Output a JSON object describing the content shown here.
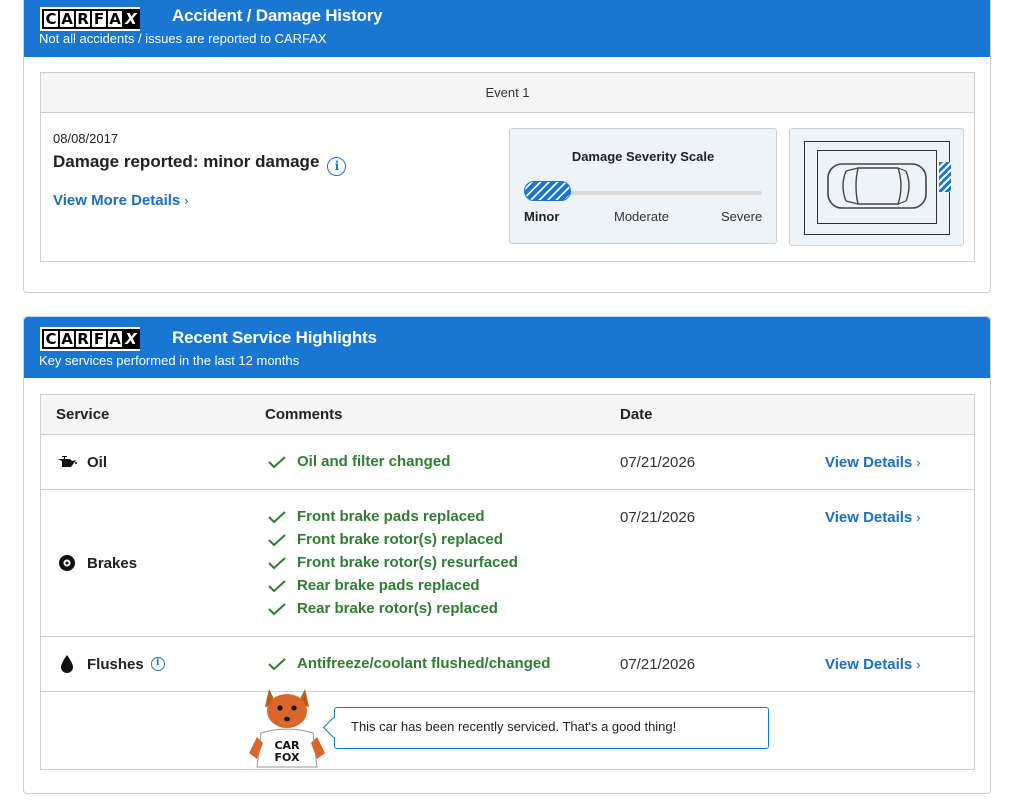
{
  "logo_letters": [
    "C",
    "A",
    "R",
    "F",
    "A",
    "X"
  ],
  "accident": {
    "title": "Accident / Damage History",
    "subtitle": "Not all accidents / issues are reported to CARFAX",
    "event_label": "Event 1",
    "date": "08/08/2017",
    "summary": "Damage reported: minor damage",
    "view_more": "View More Details",
    "severity": {
      "title": "Damage Severity Scale",
      "labels": [
        "Minor",
        "Moderate",
        "Severe"
      ],
      "level": "Minor",
      "fill_fraction": 0.2
    }
  },
  "service": {
    "title": "Recent Service Highlights",
    "subtitle": "Key services performed in the last 12 months",
    "columns": [
      "Service",
      "Comments",
      "Date"
    ],
    "rows": [
      {
        "service": "Oil",
        "icon": "oil-can-icon",
        "comments": [
          "Oil and filter changed"
        ],
        "date": "07/21/2026",
        "link": "View Details"
      },
      {
        "service": "Brakes",
        "icon": "brake-disc-icon",
        "comments": [
          "Front brake pads replaced",
          "Front brake rotor(s) replaced",
          "Front brake rotor(s) resurfaced",
          "Rear brake pads replaced",
          "Rear brake rotor(s) replaced"
        ],
        "date": "07/21/2026",
        "link": "View Details"
      },
      {
        "service": "Flushes",
        "icon": "fluid-drop-icon",
        "comments": [
          "Antifreeze/coolant flushed/changed"
        ],
        "date": "07/21/2026",
        "link": "View Details"
      }
    ],
    "fox_badge": [
      "CAR",
      "FOX"
    ],
    "fox_message": "This car has been recently serviced. That's a good thing!"
  },
  "colors": {
    "brand_blue": "#1976d2",
    "link_blue": "#1b6fc2",
    "check_green": "#2e7d32"
  }
}
